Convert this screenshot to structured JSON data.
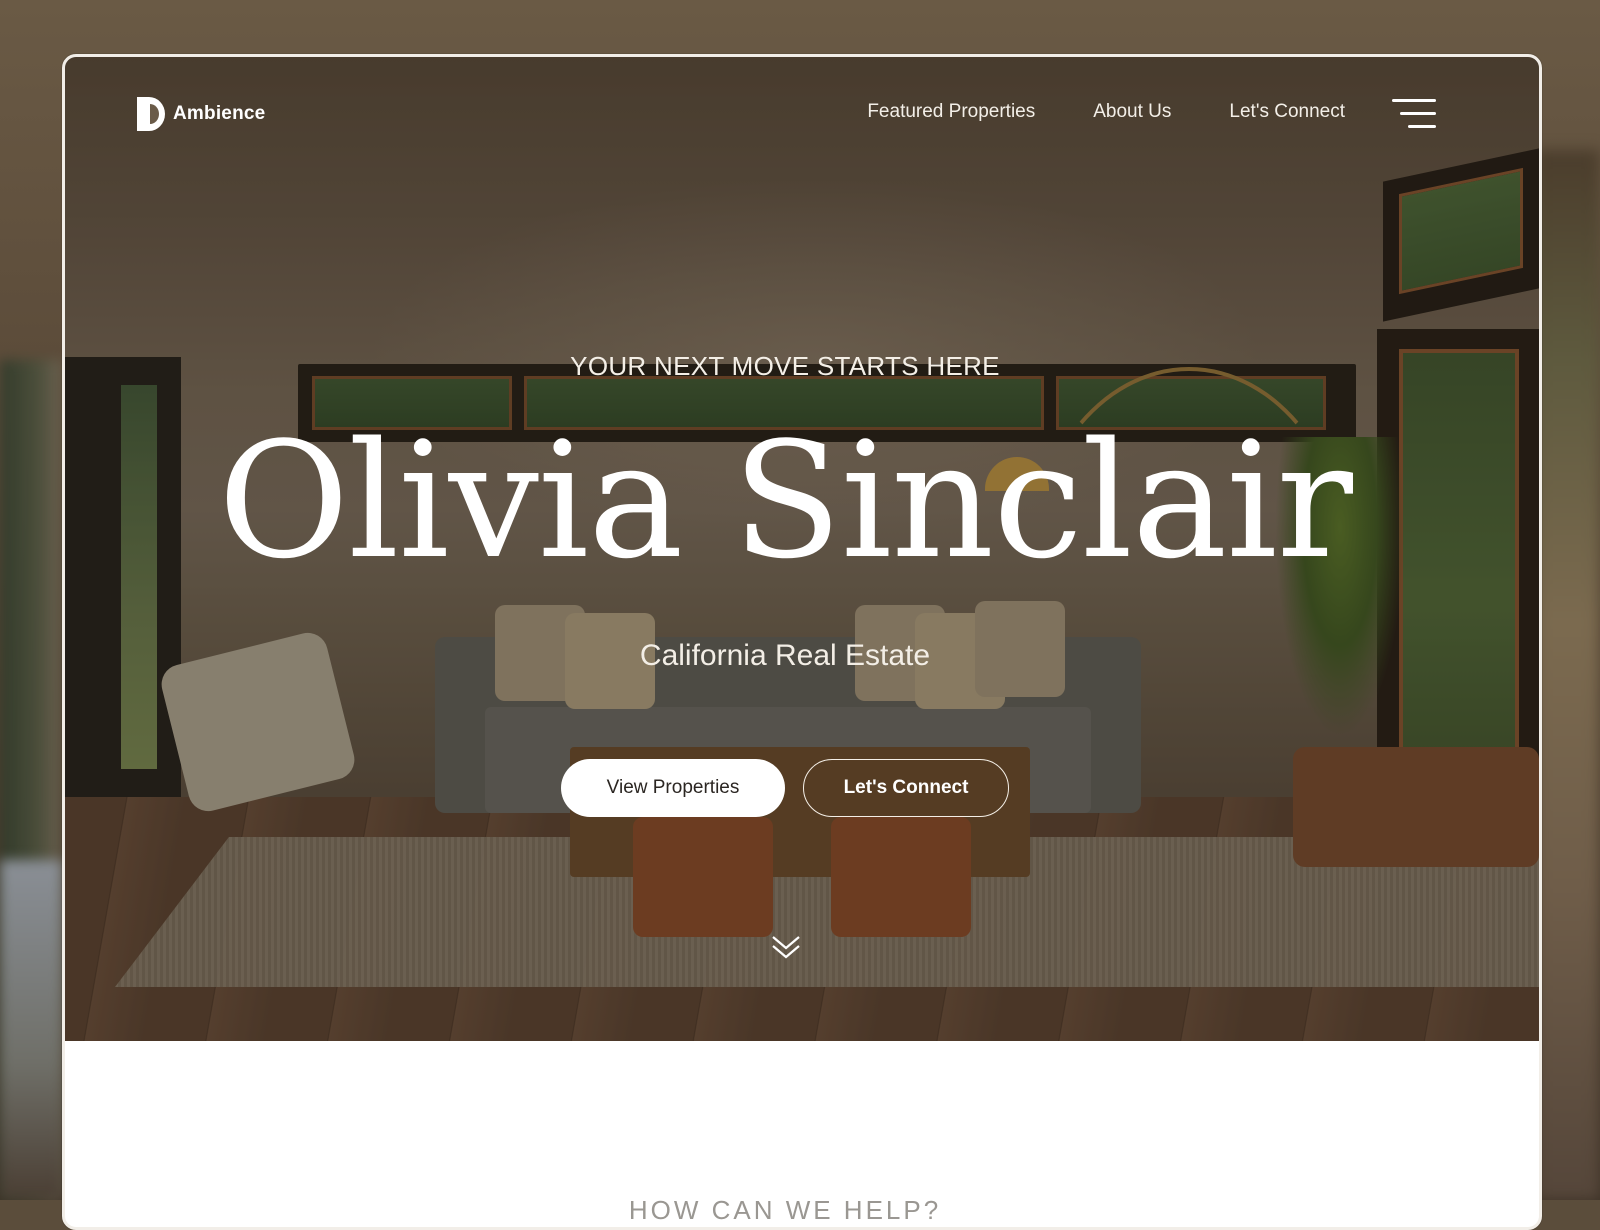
{
  "brand": {
    "name": "Ambience"
  },
  "nav": {
    "links": [
      "Featured Properties",
      "About Us",
      "Let's Connect"
    ],
    "menu_icon": "hamburger-menu-icon"
  },
  "hero": {
    "eyebrow": "YOUR NEXT MOVE STARTS HERE",
    "name": "Olivia Sinclair",
    "subtitle": "California Real Estate",
    "primary_button": "View Properties",
    "secondary_button": "Let's Connect",
    "scroll_icon": "double-chevron-down-icon"
  },
  "section": {
    "heading": "HOW CAN WE HELP?"
  },
  "colors": {
    "text_light": "#ffffff",
    "button_text_dark": "#2b2622",
    "muted_heading": "#9a9792"
  }
}
